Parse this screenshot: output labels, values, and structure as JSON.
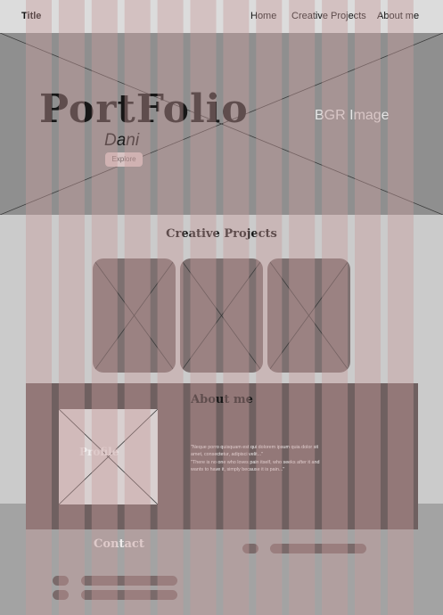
{
  "header": {
    "title": "Title",
    "nav": [
      "Home",
      "Creative Projects",
      "About me"
    ]
  },
  "hero": {
    "brand": "PortFolio",
    "name": "Dani",
    "explore_label": "Explore",
    "background_label": "BGR Image"
  },
  "projects": {
    "title": "Creative Projects",
    "cards": 3
  },
  "about": {
    "title": "About me",
    "profile_label": "Profile",
    "quote_line1": "\"Neque porro quisquam est qui dolorem ipsum quia dolor sit amet, consectetur, adipisci velit...\"",
    "quote_line2": "\"There is no one who loves pain itself, who seeks after it and wants to have it, simply because it is pain...\""
  },
  "contact": {
    "title": "Contact"
  },
  "colors": {
    "grid_column": "#c59a9a",
    "hero_bg": "#8f8f8f",
    "about_bg": "#6f6060",
    "card_bg": "#7d7070"
  }
}
